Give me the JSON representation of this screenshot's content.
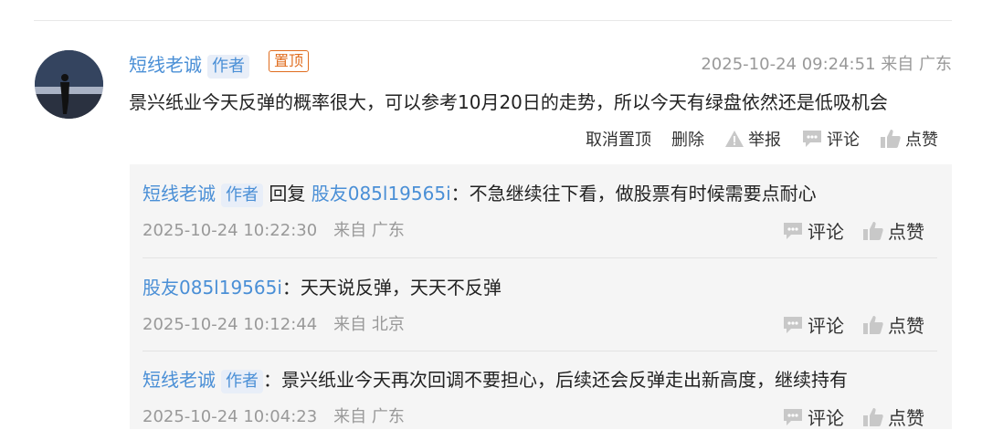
{
  "main": {
    "author": "短线老诚",
    "author_tag": "作者",
    "pin_tag": "置顶",
    "datetime": "2025-10-24 09:24:51",
    "location": "来自 广东",
    "text": "景兴纸业今天反弹的概率很大，可以参考10月20日的走势，所以今天有绿盘依然还是低吸机会",
    "actions": {
      "unpin": "取消置顶",
      "delete": "删除",
      "report": "举报",
      "comment": "评论",
      "like": "点赞"
    }
  },
  "replies": [
    {
      "author": "短线老诚",
      "author_tag": "作者",
      "reply_word": "回复",
      "reply_to": "股友085l19565i",
      "colon": "：",
      "text": "不急继续往下看，做股票有时候需要点耐心",
      "datetime": "2025-10-24 10:22:30",
      "location": "来自 广东",
      "comment": "评论",
      "like": "点赞"
    },
    {
      "author": "股友085l19565i",
      "colon": "：",
      "text": "天天说反弹，天天不反弹",
      "datetime": "2025-10-24 10:12:44",
      "location": "来自 北京",
      "comment": "评论",
      "like": "点赞"
    },
    {
      "author": "短线老诚",
      "author_tag": "作者",
      "colon": "：",
      "text": "景兴纸业今天再次回调不要担心，后续还会反弹走出新高度，继续持有",
      "datetime": "2025-10-24 10:04:23",
      "location": "来自 广东",
      "comment": "评论",
      "like": "点赞"
    }
  ],
  "colors": {
    "link": "#4a8fd6",
    "pin": "#e06d1f",
    "muted": "#999999",
    "reply_bg": "#f5f5f5"
  }
}
